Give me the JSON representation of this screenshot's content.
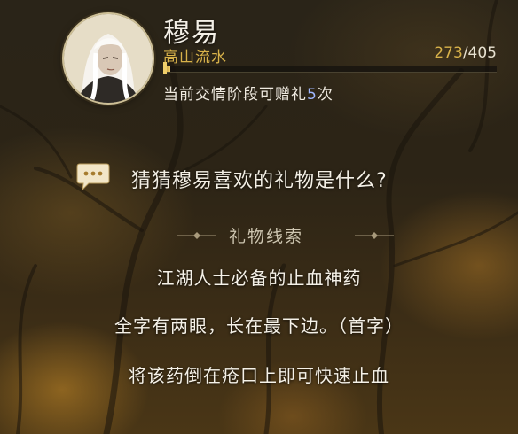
{
  "character": {
    "name": "穆易",
    "level_title": "高山流水",
    "affinity_current": "273",
    "affinity_separator": "/",
    "affinity_max": "405",
    "affinity_progress": 0.02
  },
  "gift_status": {
    "prefix": "当前交情阶段可赠礼",
    "count": "5",
    "suffix": "次"
  },
  "quiz": {
    "question": "猜猜穆易喜欢的礼物是什么?",
    "section_title": "礼物线索",
    "clues": [
      "江湖人士必备的止血神药",
      "全字有两眼，长在最下边。（首字）",
      "将该药倒在疮口上即可快速止血"
    ]
  },
  "icons": {
    "chat": "speech-bubble-icon",
    "divider": "ornament-divider-icon"
  },
  "colors": {
    "accent_gold": "#d8b24a",
    "highlight_blue": "#9fb7ff",
    "text_main": "#f4f0e6"
  }
}
